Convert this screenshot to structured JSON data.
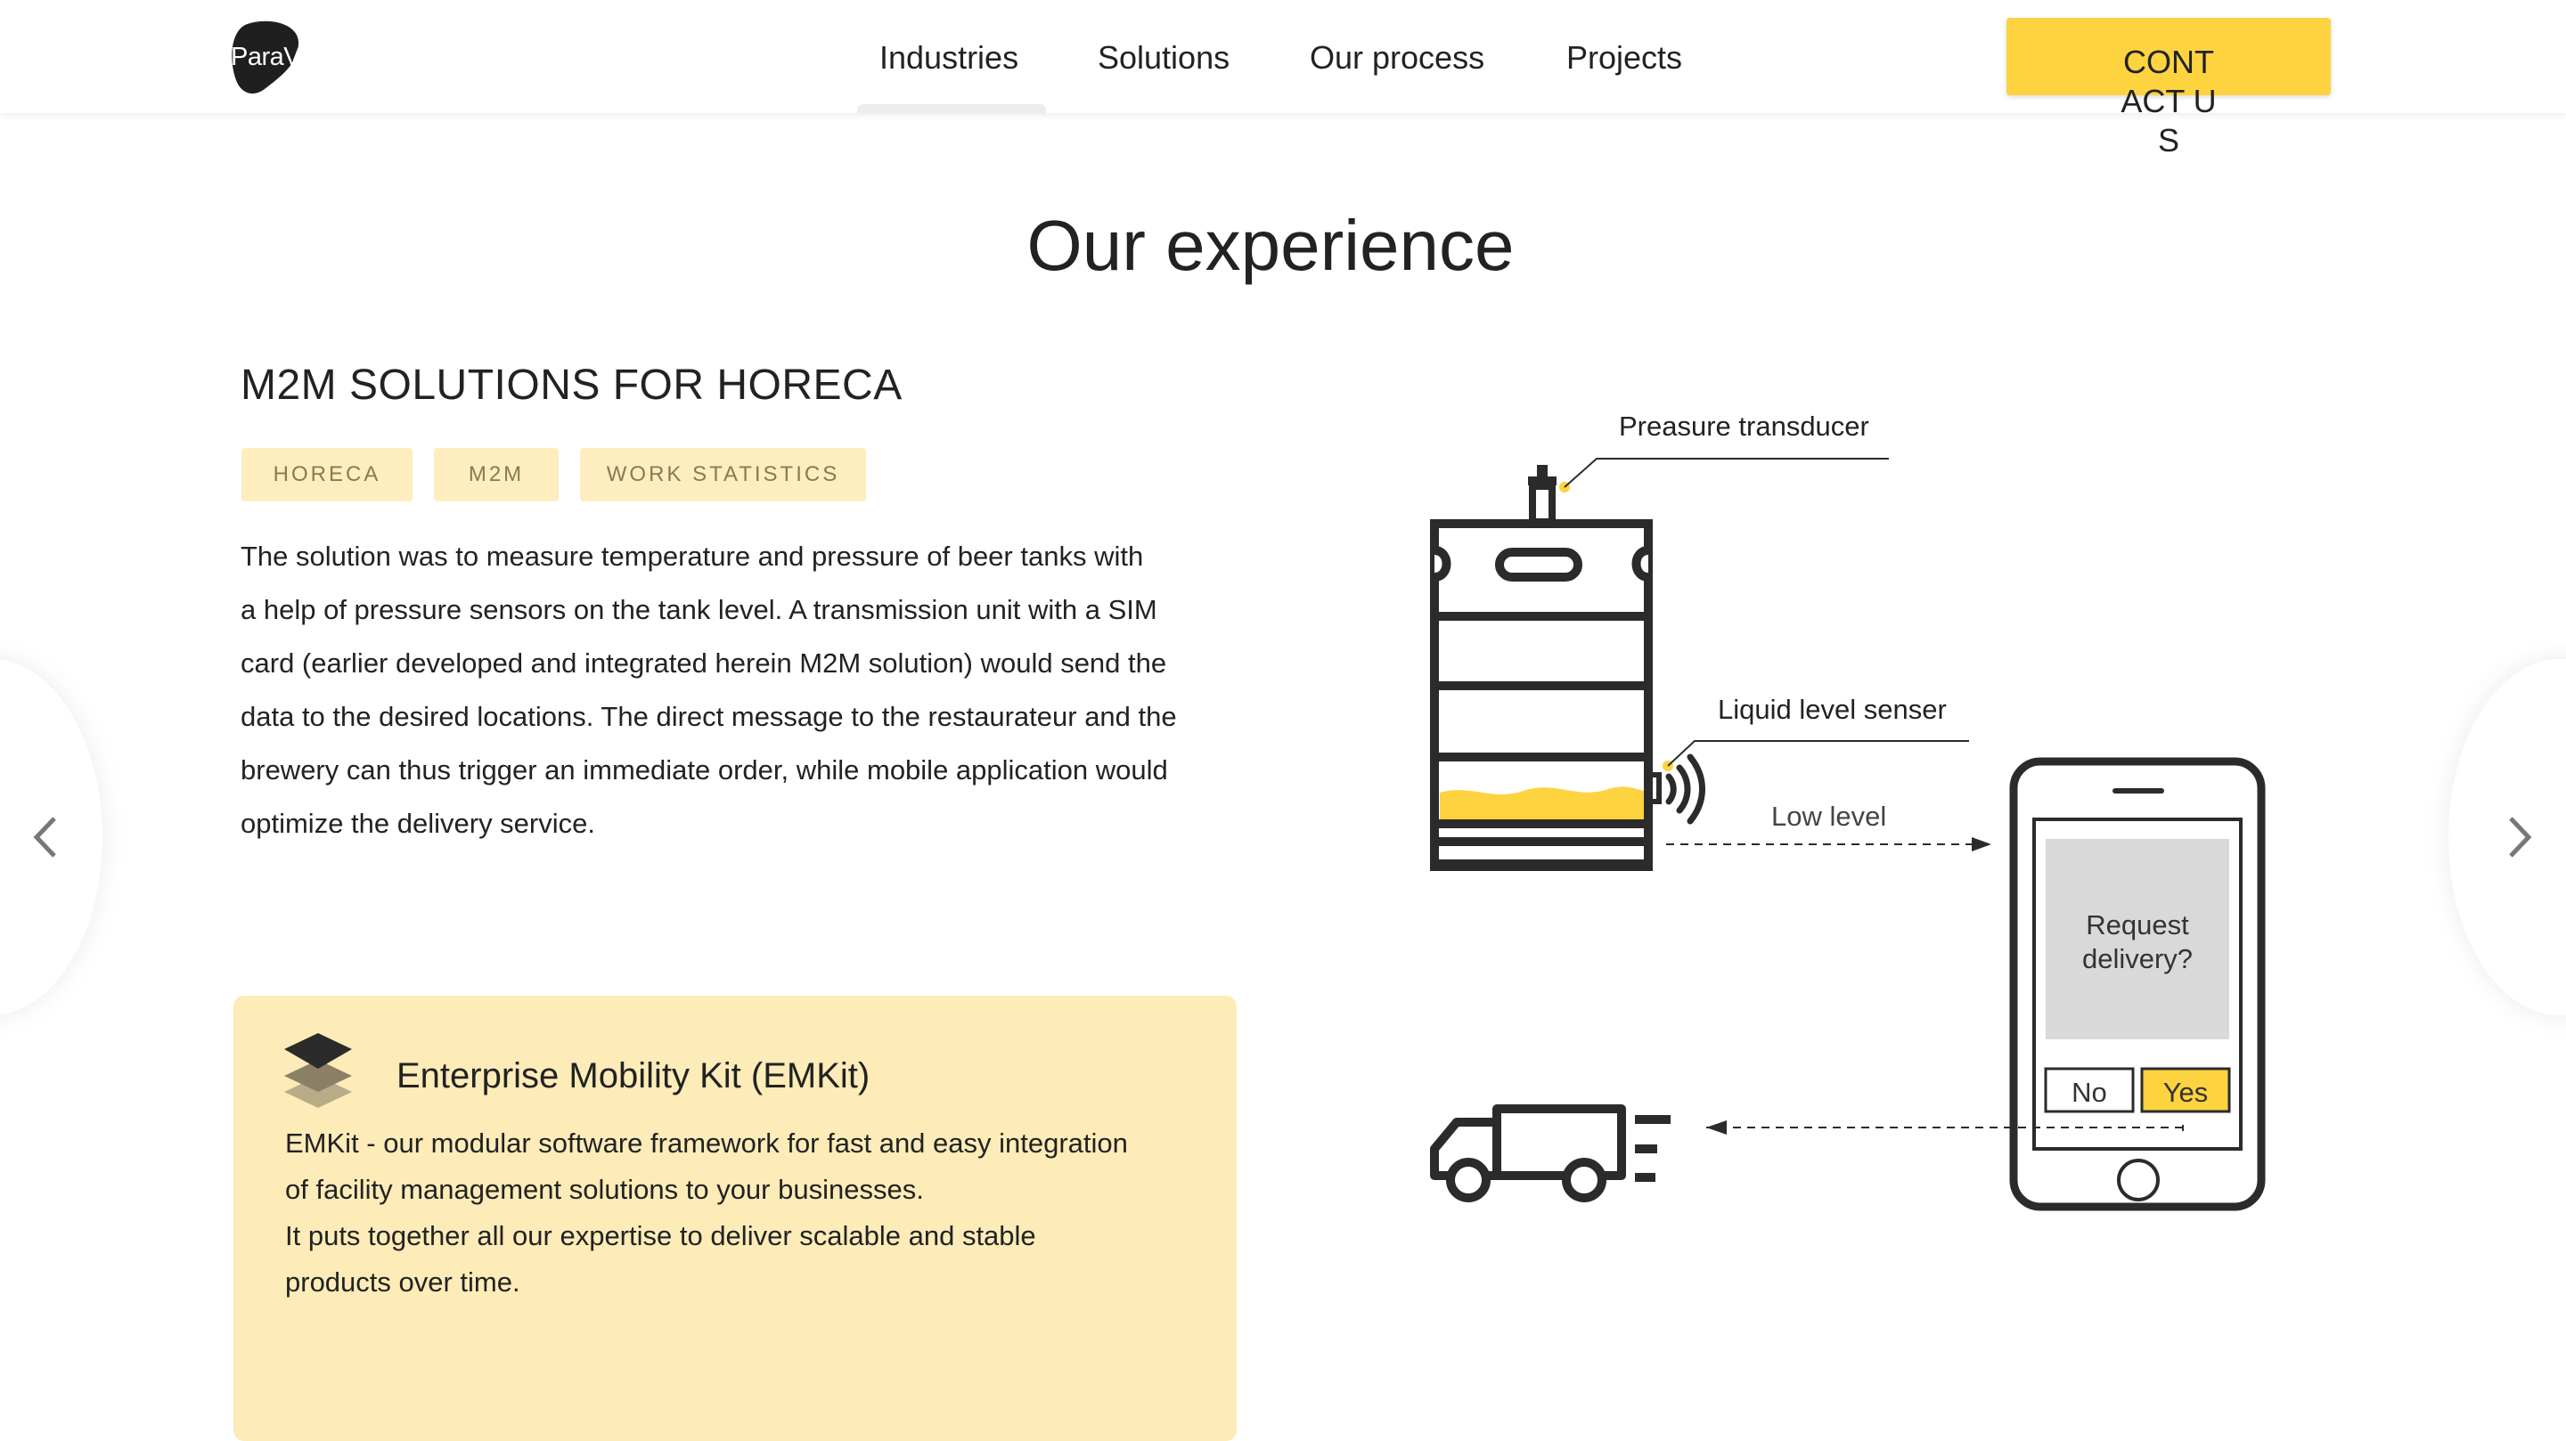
{
  "header": {
    "logo": "ParaVect",
    "nav": [
      {
        "label": "Industries",
        "active": true
      },
      {
        "label": "Solutions"
      },
      {
        "label": "Our process"
      },
      {
        "label": "Projects"
      }
    ],
    "contact_label": "CONTACT US"
  },
  "section_title": "Our experience",
  "case": {
    "title": "M2M SOLUTIONS FOR HORECA",
    "tags": [
      "HORECA",
      "M2M",
      "WORK STATISTICS"
    ],
    "description": [
      "The solution was to measure temperature and pressure of beer tanks with",
      "a help of pressure sensors on the tank level. A transmission unit with a SIM",
      "card (earlier developed and integrated herein M2M solution) would send the",
      "data to the desired locations. The direct message to the restaurateur and the",
      "brewery can thus trigger an immediate order, while mobile application would",
      "optimize the delivery service."
    ]
  },
  "emkit": {
    "title": "Enterprise Mobility Kit (EMKit)",
    "text": [
      "EMKit - our modular software framework for fast and easy integration",
      "of facility management solutions to your businesses.",
      "It puts together all our expertise to deliver scalable and stable",
      "products over time."
    ]
  },
  "diagram": {
    "pressure_label": "Preasure transducer",
    "liquid_label": "Liquid level senser",
    "low_level_label": "Low level",
    "phone_prompt": "Request delivery?",
    "no_label": "No",
    "yes_label": "Yes"
  },
  "colors": {
    "accent": "#fdd340",
    "tag_bg": "#fdedbf",
    "emkit_bg": "#fdecb8",
    "ink": "#2b2b2b"
  },
  "icons": {
    "prev": "chevron-left-icon",
    "next": "chevron-right-icon",
    "emkit": "layers-icon"
  }
}
